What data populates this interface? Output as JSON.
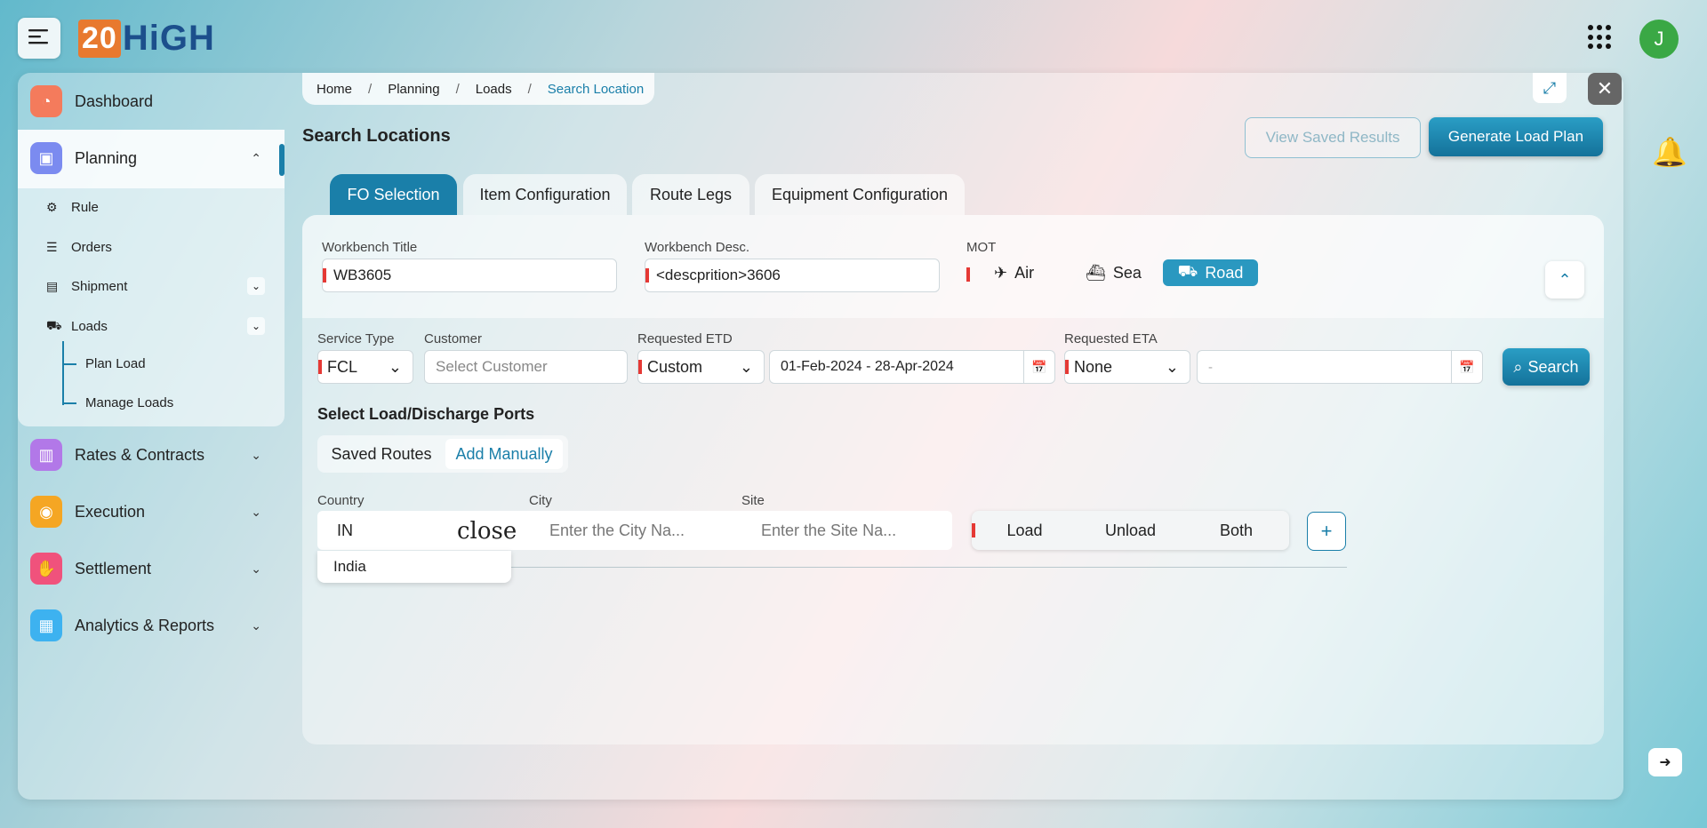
{
  "logo": {
    "num": "20",
    "text": "HiGH"
  },
  "user": {
    "initial": "J"
  },
  "sidebar": {
    "items": [
      {
        "label": "Dashboard",
        "color": "#f47b5c"
      },
      {
        "label": "Planning",
        "color": "#7b8bf0"
      },
      {
        "label": "Rates & Contracts",
        "color": "#b278e8"
      },
      {
        "label": "Execution",
        "color": "#f5a623"
      },
      {
        "label": "Settlement",
        "color": "#f0527c"
      },
      {
        "label": "Analytics & Reports",
        "color": "#3db2f0"
      }
    ],
    "sub": [
      "Rule",
      "Orders",
      "Shipment",
      "Loads"
    ],
    "tree": [
      "Plan Load",
      "Manage Loads"
    ]
  },
  "breadcrumb": [
    "Home",
    "Planning",
    "Loads",
    "Search Location"
  ],
  "page": {
    "title": "Search Locations",
    "view_saved": "View Saved Results",
    "generate": "Generate Load Plan"
  },
  "tabs": [
    "FO Selection",
    "Item Configuration",
    "Route Legs",
    "Equipment Configuration"
  ],
  "form": {
    "workbench_title_label": "Workbench Title",
    "workbench_title": "WB3605",
    "workbench_desc_label": "Workbench Desc.",
    "workbench_desc": "<descprition>3606",
    "mot_label": "MOT",
    "mot": [
      "Air",
      "Sea",
      "Road"
    ],
    "service_type_label": "Service Type",
    "service_type": "FCL",
    "customer_label": "Customer",
    "customer_placeholder": "Select Customer",
    "etd_label": "Requested ETD",
    "etd_mode": "Custom",
    "etd_range": "01-Feb-2024 - 28-Apr-2024",
    "eta_label": "Requested ETA",
    "eta_mode": "None",
    "eta_range": "-",
    "search": "Search"
  },
  "ports": {
    "heading": "Select Load/Discharge Ports",
    "toggle": [
      "Saved Routes",
      "Add Manually"
    ],
    "country_label": "Country",
    "country_value": "IN",
    "close_text": "close",
    "city_label": "City",
    "city_placeholder": "Enter the City Na...",
    "site_label": "Site",
    "site_placeholder": "Enter the Site Na...",
    "actions": [
      "Load",
      "Unload",
      "Both"
    ],
    "add": "+",
    "suggestion": "India"
  }
}
